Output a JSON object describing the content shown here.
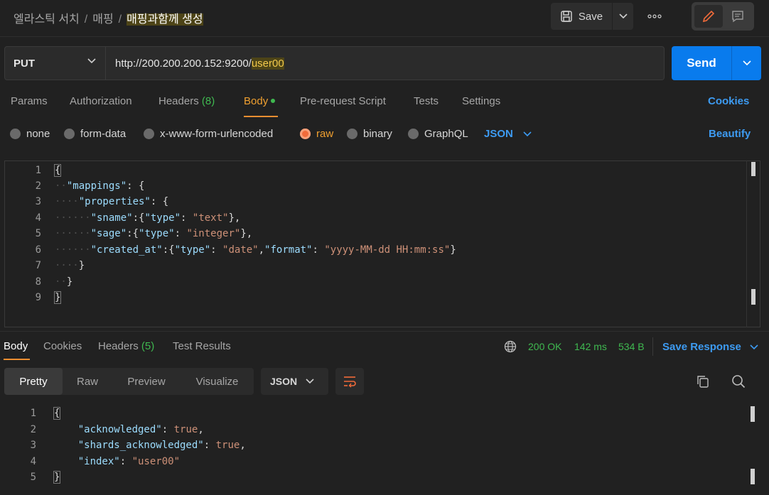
{
  "breadcrumb": {
    "items": [
      "엘라스틱 서치",
      "매핑"
    ],
    "current": "매핑과함께 생성",
    "separator": "/"
  },
  "toolbar": {
    "save_label": "Save",
    "more": "ooo"
  },
  "request": {
    "method": "PUT",
    "url_prefix": "http://200.200.200.152:9200/",
    "url_variable": "user00",
    "send_label": "Send"
  },
  "request_tabs": [
    {
      "label": "Params"
    },
    {
      "label": "Authorization"
    },
    {
      "label": "Headers",
      "count": "(8)"
    },
    {
      "label": "Body"
    },
    {
      "label": "Pre-request Script"
    },
    {
      "label": "Tests"
    },
    {
      "label": "Settings"
    }
  ],
  "cookies_label": "Cookies",
  "body_types": [
    "none",
    "form-data",
    "x-www-form-urlencoded",
    "raw",
    "binary",
    "GraphQL"
  ],
  "body_format": "JSON",
  "beautify_label": "Beautify",
  "request_body_lines": [
    "1",
    "2",
    "3",
    "4",
    "5",
    "6",
    "7",
    "8",
    "9"
  ],
  "request_body": {
    "l1": "{",
    "l2_key": "\"mappings\"",
    "l3_key": "\"properties\"",
    "l4_key": "\"sname\"",
    "l4_type_key": "\"type\"",
    "l4_type_val": "\"text\"",
    "l5_key": "\"sage\"",
    "l5_type_key": "\"type\"",
    "l5_type_val": "\"integer\"",
    "l6_key": "\"created_at\"",
    "l6_type_key": "\"type\"",
    "l6_type_val": "\"date\"",
    "l6_fmt_key": "\"format\"",
    "l6_fmt_val": "\"yyyy-MM-dd HH:mm:ss\"",
    "l7": "}",
    "l8": "}",
    "l9": "}"
  },
  "response_tabs": [
    {
      "label": "Body"
    },
    {
      "label": "Cookies"
    },
    {
      "label": "Headers",
      "count": "(5)"
    },
    {
      "label": "Test Results"
    }
  ],
  "response_status": {
    "code": "200 OK",
    "time": "142 ms",
    "size": "534 B"
  },
  "save_response_label": "Save Response",
  "view_modes": [
    "Pretty",
    "Raw",
    "Preview",
    "Visualize"
  ],
  "response_format": "JSON",
  "response_body_lines": [
    "1",
    "2",
    "3",
    "4",
    "5"
  ],
  "response_body": {
    "l1": "{",
    "l2_key": "\"acknowledged\"",
    "l2_val": "true",
    "l3_key": "\"shards_acknowledged\"",
    "l3_val": "true",
    "l4_key": "\"index\"",
    "l4_val": "\"user00\"",
    "l5": "}"
  },
  "colors": {
    "accent": "#f08e31",
    "send": "#097bed",
    "link": "#3d9bf2",
    "success": "#3fb950"
  }
}
